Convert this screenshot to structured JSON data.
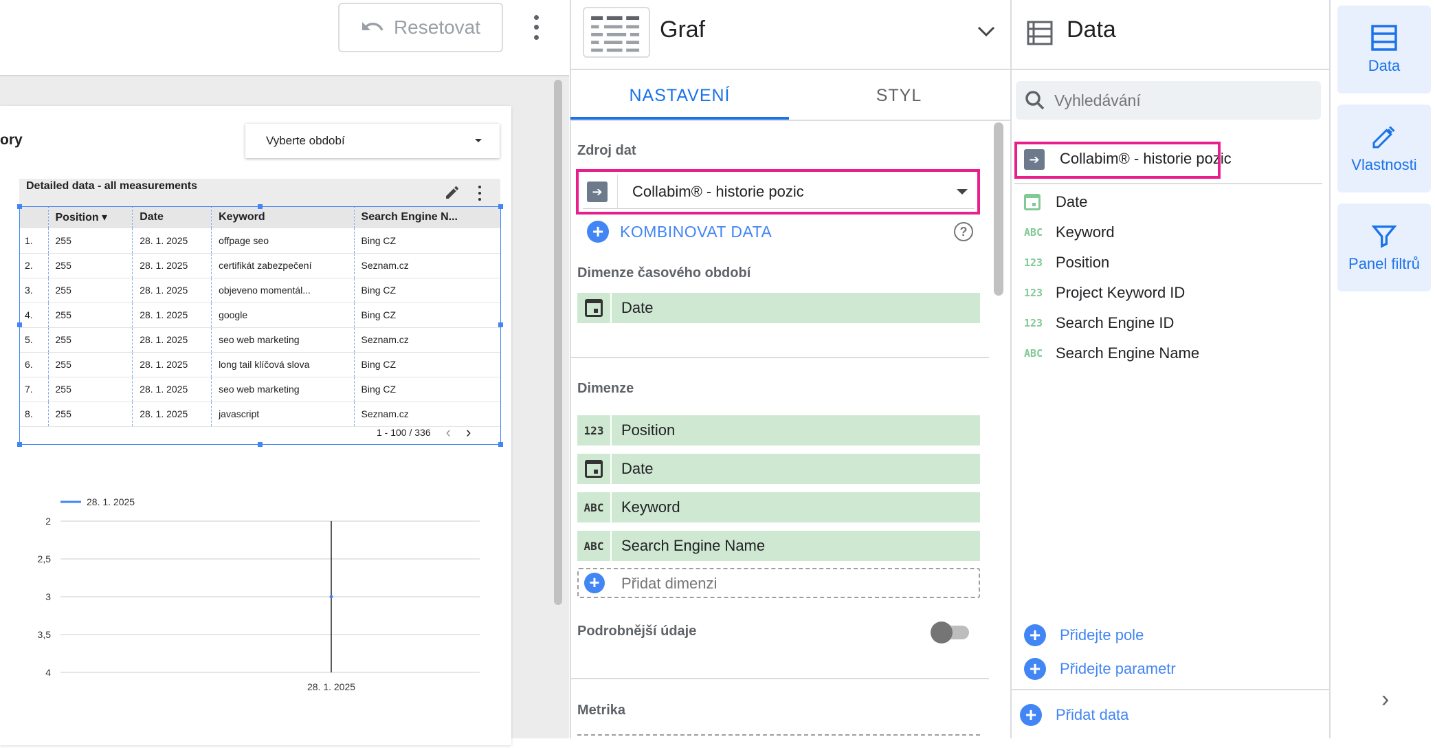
{
  "toolbar": {
    "reset_label": "Resetovat"
  },
  "report": {
    "title_fragment": "ory",
    "period_select": "Vyberte období",
    "table": {
      "title": "Detailed data - all measurements",
      "columns": [
        "",
        "Position ▾",
        "Date",
        "Keyword",
        "Search Engine N..."
      ],
      "rows": [
        [
          "1.",
          "255",
          "28. 1. 2025",
          "offpage seo",
          "Bing CZ"
        ],
        [
          "2.",
          "255",
          "28. 1. 2025",
          "certifikát zabezpečení",
          "Seznam.cz"
        ],
        [
          "3.",
          "255",
          "28. 1. 2025",
          "objeveno momentál...",
          "Bing CZ"
        ],
        [
          "4.",
          "255",
          "28. 1. 2025",
          "google",
          "Bing CZ"
        ],
        [
          "5.",
          "255",
          "28. 1. 2025",
          "seo web marketing",
          "Seznam.cz"
        ],
        [
          "6.",
          "255",
          "28. 1. 2025",
          "long tail klíčová slova",
          "Bing CZ"
        ],
        [
          "7.",
          "255",
          "28. 1. 2025",
          "seo web marketing",
          "Bing CZ"
        ],
        [
          "8.",
          "255",
          "28. 1. 2025",
          "javascript",
          "Seznam.cz"
        ]
      ],
      "pager": "1 - 100 / 336"
    }
  },
  "chart_data": {
    "type": "line",
    "x": [
      "28. 1. 2025"
    ],
    "series": [
      {
        "name": "28. 1. 2025",
        "values": [
          3
        ]
      }
    ],
    "y_ticks": [
      "2",
      "2,5",
      "3",
      "3,5",
      "4"
    ],
    "ylim": [
      4,
      2
    ],
    "y_reversed": true,
    "grid": true,
    "legend": "top-left",
    "colors": {
      "series": "#4285f4"
    }
  },
  "properties": {
    "title": "Graf",
    "tabs": [
      {
        "label": "NASTAVENÍ",
        "active": true
      },
      {
        "label": "STYL",
        "active": false
      }
    ],
    "data_source_label": "Zdroj dat",
    "data_source_name": "Collabim® - historie pozic",
    "combine_label": "KOMBINOVAT DATA",
    "date_range_dim_label": "Dimenze časového období",
    "date_range_dim": "Date",
    "dimensions_label": "Dimenze",
    "dimensions": [
      {
        "type": "123",
        "label": "Position"
      },
      {
        "type": "calendar",
        "label": "Date"
      },
      {
        "type": "ABC",
        "label": "Keyword"
      },
      {
        "type": "ABC",
        "label": "Search Engine Name"
      }
    ],
    "add_dimension": "Přidat dimenzi",
    "drilldown_label": "Podrobnější údaje",
    "drilldown_on": false,
    "metric_label": "Metrika"
  },
  "data_panel": {
    "title": "Data",
    "search_placeholder": "Vyhledávání",
    "source_name": "Collabim® - historie pozic",
    "fields": [
      {
        "type": "calendar",
        "label": "Date"
      },
      {
        "type": "ABC",
        "label": "Keyword"
      },
      {
        "type": "123",
        "label": "Position"
      },
      {
        "type": "123",
        "label": "Project Keyword ID"
      },
      {
        "type": "123",
        "label": "Search Engine ID"
      },
      {
        "type": "ABC",
        "label": "Search Engine Name"
      }
    ],
    "add_field": "Přidejte pole",
    "add_parameter": "Přidejte parametr",
    "add_data": "Přidat data"
  },
  "rail": {
    "data": "Data",
    "properties": "Vlastnosti",
    "filters": "Panel filtrů"
  },
  "colors": {
    "accent": "#1a73e8",
    "highlight": "#e91e8c",
    "chip": "#cfe8d2"
  }
}
